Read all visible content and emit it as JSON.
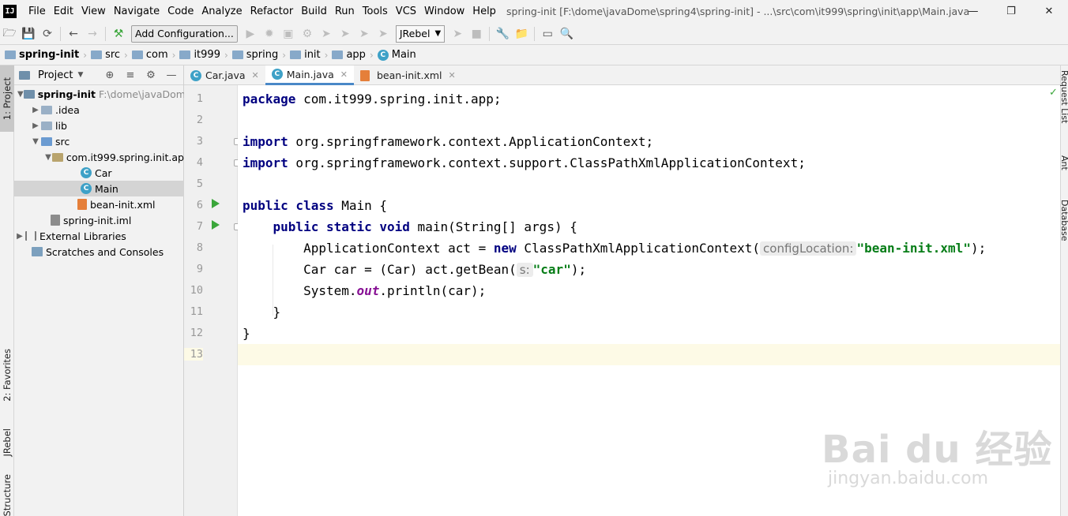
{
  "menu": [
    "File",
    "Edit",
    "View",
    "Navigate",
    "Code",
    "Analyze",
    "Refactor",
    "Build",
    "Run",
    "Tools",
    "VCS",
    "Window",
    "Help"
  ],
  "window_title": "spring-init [F:\\dome\\javaDome\\spring4\\spring-init] - ...\\src\\com\\it999\\spring\\init\\app\\Main.java",
  "toolbar": {
    "config_label": "Add Configuration...",
    "jrebel_label": "JRebel"
  },
  "breadcrumb": [
    "spring-init",
    "src",
    "com",
    "it999",
    "spring",
    "init",
    "app",
    "Main"
  ],
  "left_tabs": {
    "project": "1: Project",
    "favorites": "2: Favorites",
    "jrebel": "JRebel",
    "structure": "Structure"
  },
  "project_panel": {
    "title": "Project",
    "tree": [
      {
        "label": "spring-init",
        "extra": "F:\\dome\\javaDom"
      },
      {
        "label": ".idea"
      },
      {
        "label": "lib"
      },
      {
        "label": "src"
      },
      {
        "label": "com.it999.spring.init.ap"
      },
      {
        "label": "Car"
      },
      {
        "label": "Main"
      },
      {
        "label": "bean-init.xml"
      },
      {
        "label": "spring-init.iml"
      },
      {
        "label": "External Libraries"
      },
      {
        "label": "Scratches and Consoles"
      }
    ]
  },
  "editor_tabs": [
    "Car.java",
    "Main.java",
    "bean-init.xml"
  ],
  "line_numbers": [
    "1",
    "2",
    "3",
    "4",
    "5",
    "6",
    "7",
    "8",
    "9",
    "10",
    "11",
    "12",
    "13"
  ],
  "code": {
    "l1_kw": "package",
    "l1_rest": " com.it999.spring.init.app;",
    "l3_kw": "import",
    "l3_rest": " org.springframework.context.ApplicationContext;",
    "l4_kw": "import",
    "l4_rest": " org.springframework.context.support.ClassPathXmlApplicationContext;",
    "l6_kw": "public class",
    "l6_rest": " Main {",
    "l7_indent": "    ",
    "l7_kw": "public static void",
    "l7_rest": " main(String[] args) {",
    "l8_a": "        ApplicationContext act = ",
    "l8_kw": "new",
    "l8_b": " ClassPathXmlApplicationContext(",
    "l8_hint": "configLocation:",
    "l8_str": "\"bean-init.xml\"",
    "l8_c": ");",
    "l9_a": "        Car car = (Car) act.getBean(",
    "l9_hint": "s:",
    "l9_str": "\"car\"",
    "l9_c": ");",
    "l10_a": "        System.",
    "l10_fld": "out",
    "l10_b": ".println(car);",
    "l11": "    }",
    "l12": "}"
  },
  "right_tabs": [
    "Request List",
    "Ant",
    "Database"
  ],
  "watermark": {
    "main": "Bai du 经验",
    "sub": "jingyan.baidu.com"
  }
}
